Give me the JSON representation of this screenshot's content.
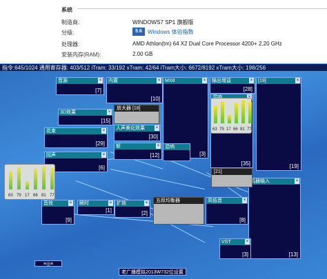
{
  "system": {
    "section": "系统",
    "rows": [
      {
        "label": "制造商:",
        "value": "WINDOWS7 SP1 旗舰版"
      },
      {
        "label": "分级:",
        "value": ""
      },
      {
        "label": "处理器:",
        "value": "AMD Athlon(tm) 64 X2 Dual Core Processor 4200+   2.20 GHz"
      },
      {
        "label": "安装内存(RAM):",
        "value": "2.00 GB"
      }
    ],
    "rating_badge": "5.6",
    "rating_link": "Windows 体验指数"
  },
  "status_bar": "指令:645/1024 通用寄存器: 403/512 iTram: 33/192 xTram: 42/64 iTram大小: 6672/8192 xTram大小: 198/256",
  "modules": [
    {
      "name": "音源",
      "num": "[7]"
    },
    {
      "name": "内置",
      "num": "[10]"
    },
    {
      "name": "MX8",
      "num": "[3]"
    },
    {
      "name": "输出增益",
      "num": "[28]"
    },
    {
      "name": "3D效果",
      "num": "[15]"
    },
    {
      "name": "放大器",
      "num": "[18]"
    },
    {
      "name": "人声美化效果",
      "num": "[30]"
    },
    {
      "name": "花束",
      "num": "[29]"
    },
    {
      "name": "斩",
      "num": "[12]"
    },
    {
      "name": "混响",
      "num": "[35]"
    },
    {
      "name": "回声",
      "num": "[6]"
    },
    {
      "name": "[19]",
      "num": "[19]"
    },
    {
      "name": "音效",
      "num": "[9]"
    },
    {
      "name": "瞬时",
      "num": "[1]"
    },
    {
      "name": "扩效",
      "num": "[2]"
    },
    {
      "name": "五段均衡器",
      "num": "[5]"
    },
    {
      "name": "高低音",
      "num": "[8]"
    },
    {
      "name": "机器输入",
      "num": "[13]"
    },
    {
      "name": "VST",
      "num": "[3]"
    },
    {
      "name": "[21]",
      "num": "[21]"
    }
  ],
  "meter_values": [
    "63",
    "79",
    "17",
    "66",
    "81",
    "77"
  ],
  "bottom_button": "老广播模拟2013W732位设置",
  "small_button": "≡◎≡"
}
